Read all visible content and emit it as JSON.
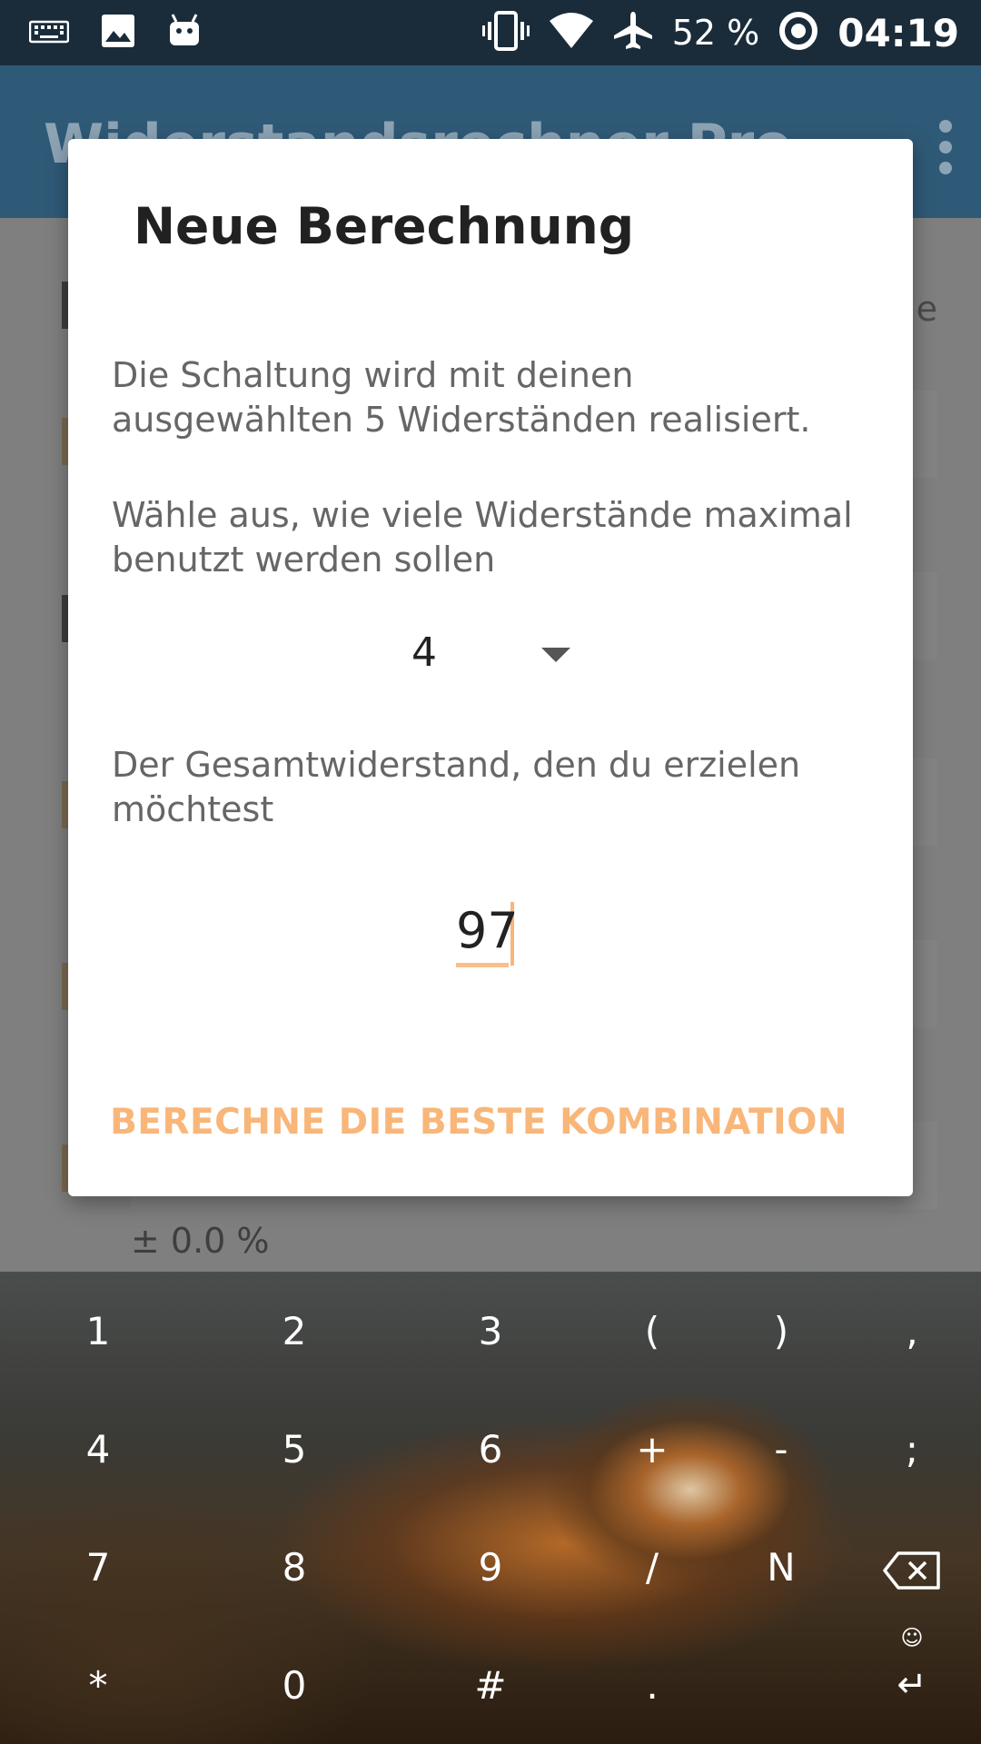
{
  "status_bar": {
    "battery_percent": "52 %",
    "time": "04:19",
    "icons": [
      "keyboard-icon",
      "image-icon",
      "android-icon",
      "vibrate-icon",
      "wifi-icon",
      "airplane-icon",
      "data-saver-icon"
    ]
  },
  "app": {
    "title": "Widerstandsrechner Pro",
    "partial_text": "e",
    "tolerance": "± 0.0 %"
  },
  "dialog": {
    "title": "Neue Berechnung",
    "text1": "Die Schaltung wird mit deinen ausgewählten 5 Widerständen realisiert.",
    "text2": "Wähle aus, wie viele Widerstände maximal benutzt werden sollen",
    "spinner_value": "4",
    "text3": "Der Gesamtwiderstand, den du erzielen möchtest",
    "input_value": "97",
    "action_label": "BERECHNE DIE BESTE KOMBINATION"
  },
  "keyboard": {
    "keys": [
      "1",
      "2",
      "3",
      "(",
      ")",
      ",",
      "4",
      "5",
      "6",
      "+",
      "-",
      ";",
      "7",
      "8",
      "9",
      "/",
      "N",
      "*",
      "0",
      "#",
      "."
    ],
    "emoji_glyph": "☺",
    "enter_glyph": "↵"
  }
}
